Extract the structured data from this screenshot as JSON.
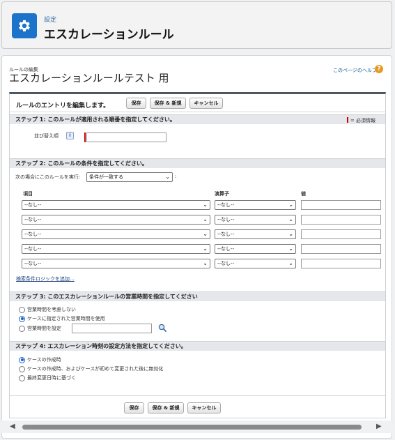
{
  "header": {
    "breadcrumb": "設定",
    "title": "エスカレーションルール"
  },
  "page": {
    "edit_caption": "ルールの編集",
    "rule_name": "エスカレーションルールテスト 用",
    "help_link": "このページのヘルプ",
    "help_icon": "?"
  },
  "panel": {
    "title": "ルールのエントリを編集します。",
    "buttons": {
      "save": "保存",
      "save_new": "保存 & 新規",
      "cancel": "キャンセル"
    }
  },
  "step1": {
    "title": "ステップ 1: このルールが適用される順番を指定してください。",
    "required_legend": "= 必須情報",
    "sort_label": "並び替え順",
    "info_icon": "i",
    "sort_value": ""
  },
  "step2": {
    "title": "ステップ 2: このルールの条件を指定してください。",
    "run_label": "次の場合にこのルールを実行:",
    "run_select": "条件が一致する",
    "colon": ":",
    "columns": {
      "field": "項目",
      "operator": "演算子",
      "value": "値"
    },
    "rows": [
      {
        "field": "--なし--",
        "operator": "--なし--",
        "value": ""
      },
      {
        "field": "--なし--",
        "operator": "--なし--",
        "value": ""
      },
      {
        "field": "--なし--",
        "operator": "--なし--",
        "value": ""
      },
      {
        "field": "--なし--",
        "operator": "--なし--",
        "value": ""
      },
      {
        "field": "--なし--",
        "operator": "--なし--",
        "value": ""
      }
    ],
    "add_logic_link": "検索条件ロジックを追加..."
  },
  "step3": {
    "title": "ステップ 3: このエスカレーションルールの営業時間を指定してください",
    "options": [
      "営業時間を考慮しない",
      "ケースに指定された営業時間を使用",
      "営業時間を設定"
    ],
    "selected": 1,
    "hours_value": ""
  },
  "step4": {
    "title": "ステップ 4: エスカレーション時刻の設定方法を指定してください。",
    "options": [
      "ケースの作成時",
      "ケースの作成時、およびケースが初めて変更された後に無効化",
      "最終変更日時に基づく"
    ],
    "selected": 0
  },
  "colors": {
    "brand": "#1d73c9",
    "required": "#cc0000",
    "link": "#1a5fa0"
  },
  "icons": {
    "header": "gear-icon",
    "help": "help-icon",
    "info": "info-icon",
    "lookup": "lookup-icon"
  }
}
